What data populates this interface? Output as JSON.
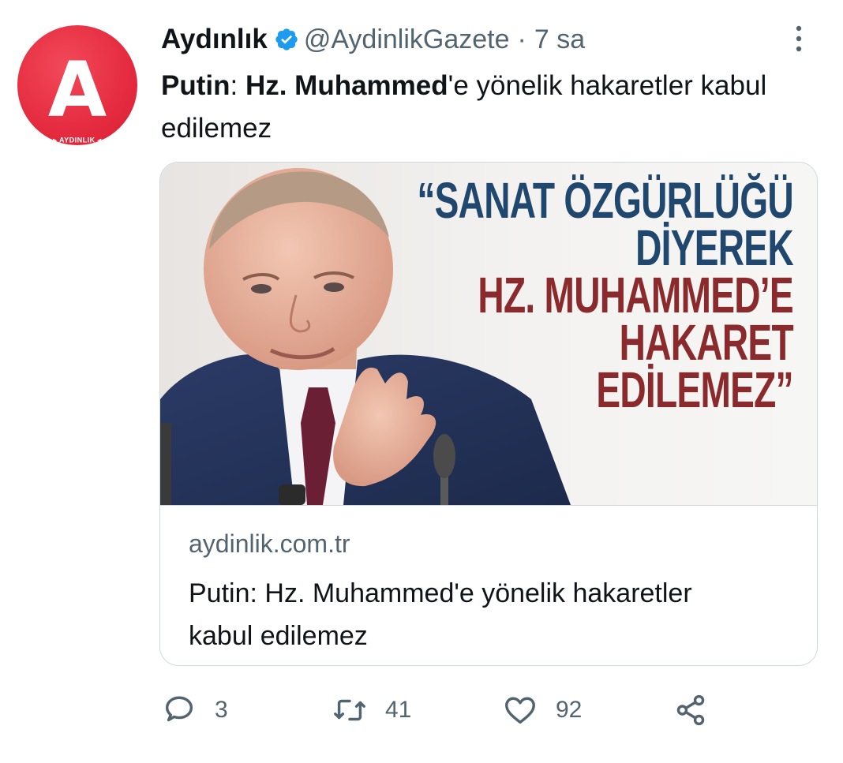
{
  "account": {
    "display_name": "Aydınlık",
    "handle": "@AydinlikGazete",
    "separator": "·",
    "timestamp": "7 sa",
    "avatar_letter": "A",
    "avatar_wordmark": "▸ AYDINLIK ◂",
    "brand_color": "#e52b3f"
  },
  "tweet": {
    "text_bold_1": "Putin",
    "text_1": ": ",
    "text_bold_2": "Hz. Muhammed",
    "text_2": "'e yönelik hakaretler kabul edilemez"
  },
  "card": {
    "image_quote_lines": [
      "“SANAT ÖZGÜRLÜĞÜ",
      "DİYEREK",
      "HZ. MUHAMMED’E",
      "HAKARET",
      "EDİLEMEZ”"
    ],
    "quote_colors": {
      "blue": "#20476e",
      "red": "#8a2a2c"
    },
    "domain": "aydinlik.com.tr",
    "title": "Putin: Hz. Muhammed'e yönelik hakaretler kabul edilemez"
  },
  "actions": {
    "reply_icon": "reply-icon",
    "reply_count": "3",
    "retweet_icon": "retweet-icon",
    "retweet_count": "41",
    "like_icon": "heart-icon",
    "like_count": "92",
    "share_icon": "share-icon"
  },
  "colors": {
    "verified": "#1d9bf0",
    "secondary_text": "#536471",
    "primary_text": "#0f1419",
    "border": "#cfd9de"
  }
}
